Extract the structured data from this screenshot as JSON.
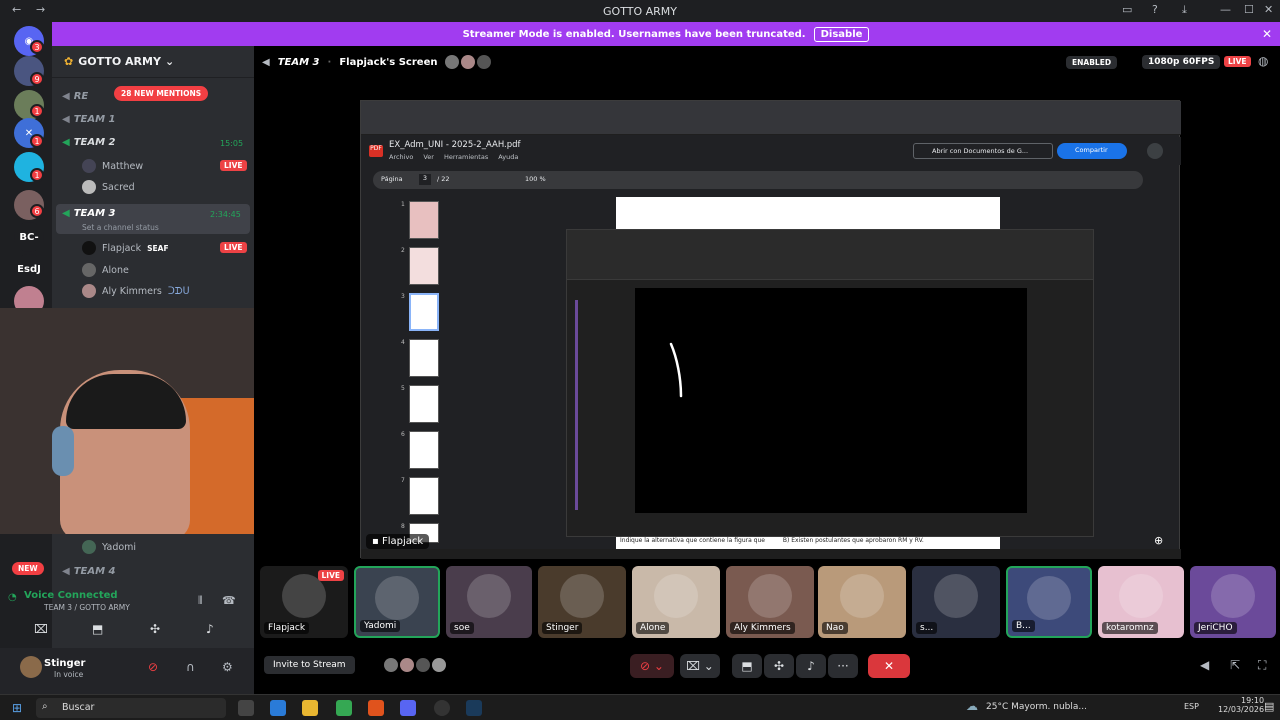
{
  "window": {
    "title": "GOTTO ARMY"
  },
  "banner": {
    "text": "Streamer Mode is enabled. Usernames have been truncated.",
    "button": "Disable"
  },
  "servers": [
    {
      "label": "",
      "badge": "3"
    },
    {
      "label": "",
      "badge": "9"
    },
    {
      "label": "",
      "badge": "1"
    },
    {
      "label": "",
      "badge": "1"
    },
    {
      "label": "",
      "badge": "1"
    },
    {
      "label": "",
      "badge": "6"
    },
    {
      "label": "BC-",
      "badge": ""
    },
    {
      "label": "EsdJ",
      "badge": ""
    },
    {
      "label": "",
      "badge": ""
    }
  ],
  "server": {
    "name": "GOTTO ARMY",
    "mentions": "28 NEW MENTIONS"
  },
  "channels": [
    {
      "name": "RE",
      "time": ""
    },
    {
      "name": "TEAM 1",
      "time": ""
    },
    {
      "name": "TEAM 2",
      "time": "15:05"
    },
    {
      "name": "TEAM 3",
      "time": "2:34:45",
      "status": "Set a channel status"
    },
    {
      "name": "TEAM 4",
      "time": ""
    }
  ],
  "team2_members": [
    {
      "name": "Matthew",
      "live": "LIVE"
    },
    {
      "name": "Sacred",
      "live": ""
    }
  ],
  "team3_members": [
    {
      "name": "Flapjack",
      "tag": "SEAF",
      "live": "LIVE"
    },
    {
      "name": "Alone",
      "tag": "",
      "live": ""
    },
    {
      "name": "Aly Kimmers",
      "tag": "ᑐᗪᑌ",
      "live": ""
    }
  ],
  "other_member": "Yadomi",
  "new_badge": "NEW",
  "voice": {
    "status": "Voice Connected",
    "channel": "TEAM 3 / GOTTO ARMY"
  },
  "user": {
    "name": "Stinger",
    "status": "In voice"
  },
  "stage": {
    "channel": "TEAM 3",
    "screen_title": "Flapjack's Screen",
    "enabled": "ENABLED",
    "quality": "1080p 60FPS",
    "live": "LIVE",
    "stream_label": "Flapjack"
  },
  "pdf": {
    "filename": "EX_Adm_UNI - 2025-2_AAH.pdf",
    "menu": [
      "Archivo",
      "Ver",
      "Herramientas",
      "Ayuda"
    ],
    "open_btn": "Abrir con Documentos de G...",
    "share": "Compartir",
    "page_label": "Página",
    "page": "3",
    "total": "/ 22",
    "zoom": "100 %",
    "page_numbers": [
      "1",
      "2",
      "3",
      "4",
      "5",
      "6",
      "7",
      "8"
    ],
    "bottom_text_a": "Indique la alternativa que contiene la figura que",
    "bottom_text_b": "B)   Existen postulantes que aprobaron RM y RV."
  },
  "participants": [
    {
      "name": "Flapjack",
      "live": "LIVE",
      "color": "#1b1b1b"
    },
    {
      "name": "Yadomi",
      "live": "",
      "color": "#3a4350"
    },
    {
      "name": "soe",
      "live": "",
      "color": "#4a3d4c"
    },
    {
      "name": "Stinger",
      "live": "",
      "color": "#4a3b2c"
    },
    {
      "name": "Alone",
      "live": "",
      "color": "#c9b9a9"
    },
    {
      "name": "Aly Kimmers",
      "live": "",
      "color": "#7a5a50"
    },
    {
      "name": "Nao",
      "live": "",
      "color": "#b99a7a"
    },
    {
      "name": "s...",
      "live": "",
      "color": "#2a2f40"
    },
    {
      "name": "B...",
      "live": "",
      "color": "#3d4a7a"
    },
    {
      "name": "kotaromnz",
      "live": "",
      "color": "#e7c0d0"
    },
    {
      "name": "JeriCHO",
      "live": "",
      "color": "#6b4a9a"
    }
  ],
  "invite": "Invite to Stream",
  "taskbar": {
    "search": "Buscar",
    "weather": "25°C  Mayorm. nubla...",
    "lang": "ESP",
    "time": "19:10",
    "date": "12/03/2026"
  }
}
